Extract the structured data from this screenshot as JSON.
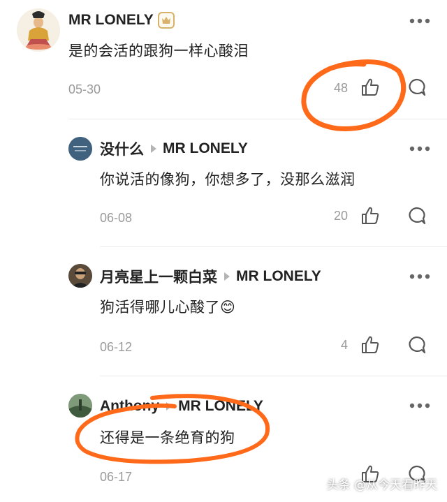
{
  "comments": [
    {
      "user": "MR LONELY",
      "text": "是的会活的跟狗一样心酸泪",
      "date": "05-30",
      "likes": "48"
    },
    {
      "user": "没什么",
      "reply_to": "MR LONELY",
      "text": "你说活的像狗，你想多了，没那么滋润",
      "date": "06-08",
      "likes": "20"
    },
    {
      "user": "月亮星上一颗白菜",
      "reply_to": "MR LONELY",
      "text": "狗活得哪儿心酸了",
      "emoji": "😊",
      "date": "06-12",
      "likes": "4"
    },
    {
      "user": "Anthony",
      "reply_to": "MR LONELY",
      "text": "还得是一条绝育的狗",
      "date": "06-17",
      "likes": ""
    }
  ],
  "watermark": "头条 @从今天看昨天",
  "colors": {
    "annotation": "#ff6a1a",
    "muted": "#9a9a9a",
    "badge": "#d8b26a"
  },
  "icons": [
    "more-icon",
    "like-icon",
    "reply-icon",
    "vip-badge-icon",
    "reply-arrow-icon"
  ]
}
